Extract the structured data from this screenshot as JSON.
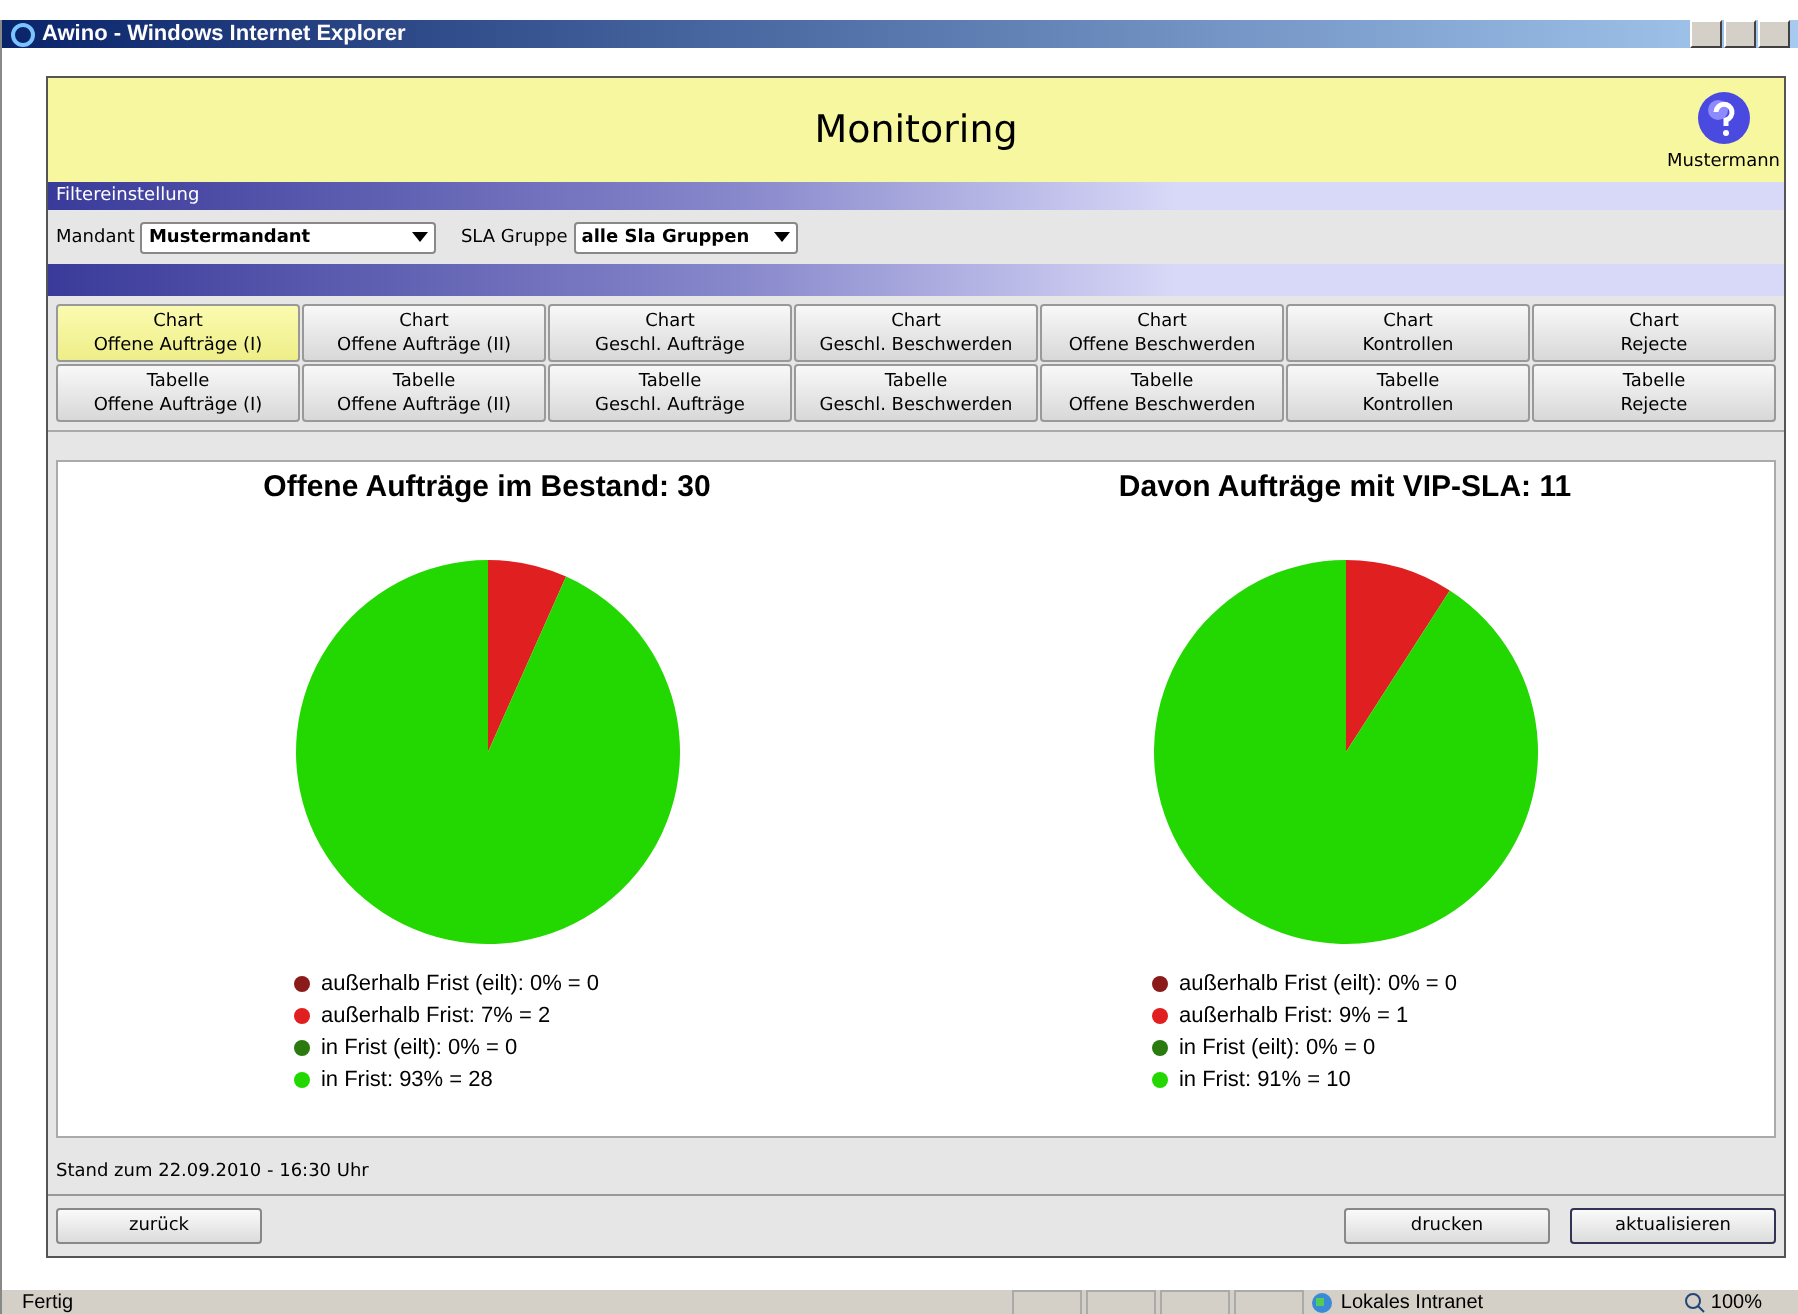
{
  "window": {
    "title": "Awino - Windows Internet Explorer"
  },
  "header": {
    "title": "Monitoring",
    "user": "Mustermann"
  },
  "filter": {
    "heading": "Filtereinstellung",
    "fields": [
      {
        "label": "Mandant",
        "value": "Mustermandant"
      },
      {
        "label": "SLA Gruppe",
        "value": "alle Sla Gruppen"
      }
    ]
  },
  "tabs": [
    {
      "label": "Chart",
      "sub": "Offene Aufträge (I)",
      "selected": true
    },
    {
      "label": "Chart",
      "sub": "Offene Aufträge (II)",
      "selected": false
    },
    {
      "label": "Chart",
      "sub": "Geschl. Aufträge",
      "selected": false
    },
    {
      "label": "Chart",
      "sub": "Geschl. Beschwerden",
      "selected": false
    },
    {
      "label": "Chart",
      "sub": "Offene Beschwerden",
      "selected": false
    },
    {
      "label": "Chart",
      "sub": "Kontrollen",
      "selected": false
    },
    {
      "label": "Chart",
      "sub": "Rejecte",
      "selected": false
    },
    {
      "label": "Tabelle",
      "sub": "Offene Aufträge (I)",
      "selected": false
    },
    {
      "label": "Tabelle",
      "sub": "Offene Aufträge (II)",
      "selected": false
    },
    {
      "label": "Tabelle",
      "sub": "Geschl. Aufträge",
      "selected": false
    },
    {
      "label": "Tabelle",
      "sub": "Geschl. Beschwerden",
      "selected": false
    },
    {
      "label": "Tabelle",
      "sub": "Offene Beschwerden",
      "selected": false
    },
    {
      "label": "Tabelle",
      "sub": "Kontrollen",
      "selected": false
    },
    {
      "label": "Tabelle",
      "sub": "Rejecte",
      "selected": false
    }
  ],
  "charts": [
    {
      "chart_data": {
        "type": "pie",
        "title": "Offene Aufträge im Bestand: 30",
        "categories": [
          "außerhalb Frist (eilt): 0% = 0",
          "außerhalb Frist: 7% = 2",
          "in Frist (eilt): 0% = 0",
          "in Frist: 93% = 28"
        ],
        "series": [
          {
            "colors": [
              "#8b1a1a",
              "#e02020",
              "#2a7a10",
              "#22d800"
            ],
            "values": [
              0,
              2,
              0,
              28
            ]
          }
        ]
      }
    },
    {
      "chart_data": {
        "type": "pie",
        "title": "Davon Aufträge mit VIP-SLA: 11",
        "categories": [
          "außerhalb Frist (eilt): 0% = 0",
          "außerhalb Frist: 9% = 1",
          "in Frist (eilt): 0% = 0",
          "in Frist: 91% = 10"
        ],
        "series": [
          {
            "colors": [
              "#8b1a1a",
              "#e02020",
              "#2a7a10",
              "#22d800"
            ],
            "values": [
              0,
              1,
              0,
              10
            ]
          }
        ]
      }
    }
  ],
  "timestamp": "Stand zum 22.09.2010 - 16:30 Uhr",
  "buttons": [
    {
      "label": "zurück",
      "kind": "left",
      "selected": false
    },
    {
      "label": "drucken",
      "kind": "right",
      "selected": false
    },
    {
      "label": "aktualisieren",
      "kind": "right",
      "selected": true
    }
  ],
  "status_bar": {
    "text": "Fertig",
    "zone": "Lokales Intranet",
    "zoom": "100%"
  }
}
